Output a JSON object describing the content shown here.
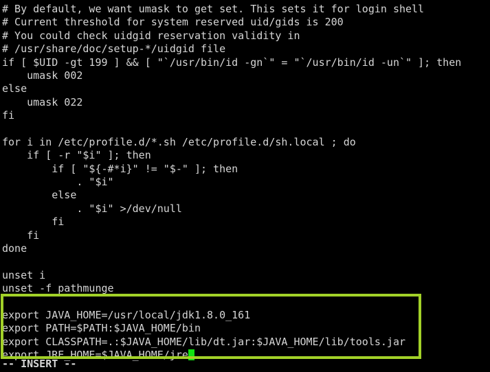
{
  "terminal": {
    "background_color": "#000000",
    "foreground_color": "#d6d6d6",
    "cursor_color": "#11e411",
    "highlight_box_color": "#a2d128",
    "lines": [
      "# By default, we want umask to get set. This sets it for login shell",
      "# Current threshold for system reserved uid/gids is 200",
      "# You could check uidgid reservation validity in",
      "# /usr/share/doc/setup-*/uidgid file",
      "if [ $UID -gt 199 ] && [ \"`/usr/bin/id -gn`\" = \"`/usr/bin/id -un`\" ]; then",
      "    umask 002",
      "else",
      "    umask 022",
      "fi",
      "",
      "for i in /etc/profile.d/*.sh /etc/profile.d/sh.local ; do",
      "    if [ -r \"$i\" ]; then",
      "        if [ \"${-#*i}\" != \"$-\" ]; then",
      "            . \"$i\"",
      "        else",
      "            . \"$i\" >/dev/null",
      "        fi",
      "    fi",
      "done",
      "",
      "unset i",
      "unset -f pathmunge",
      ""
    ],
    "boxed_lines": [
      "export JAVA_HOME=/usr/local/jdk1.8.0_161",
      "export PATH=$PATH:$JAVA_HOME/bin",
      "export CLASSPATH=.:$JAVA_HOME/lib/dt.jar:$JAVA_HOME/lib/tools.jar"
    ],
    "cursor_line_text": "export JRE_HOME=$JAVA_HOME/jre",
    "status_line": "-- INSERT --"
  }
}
